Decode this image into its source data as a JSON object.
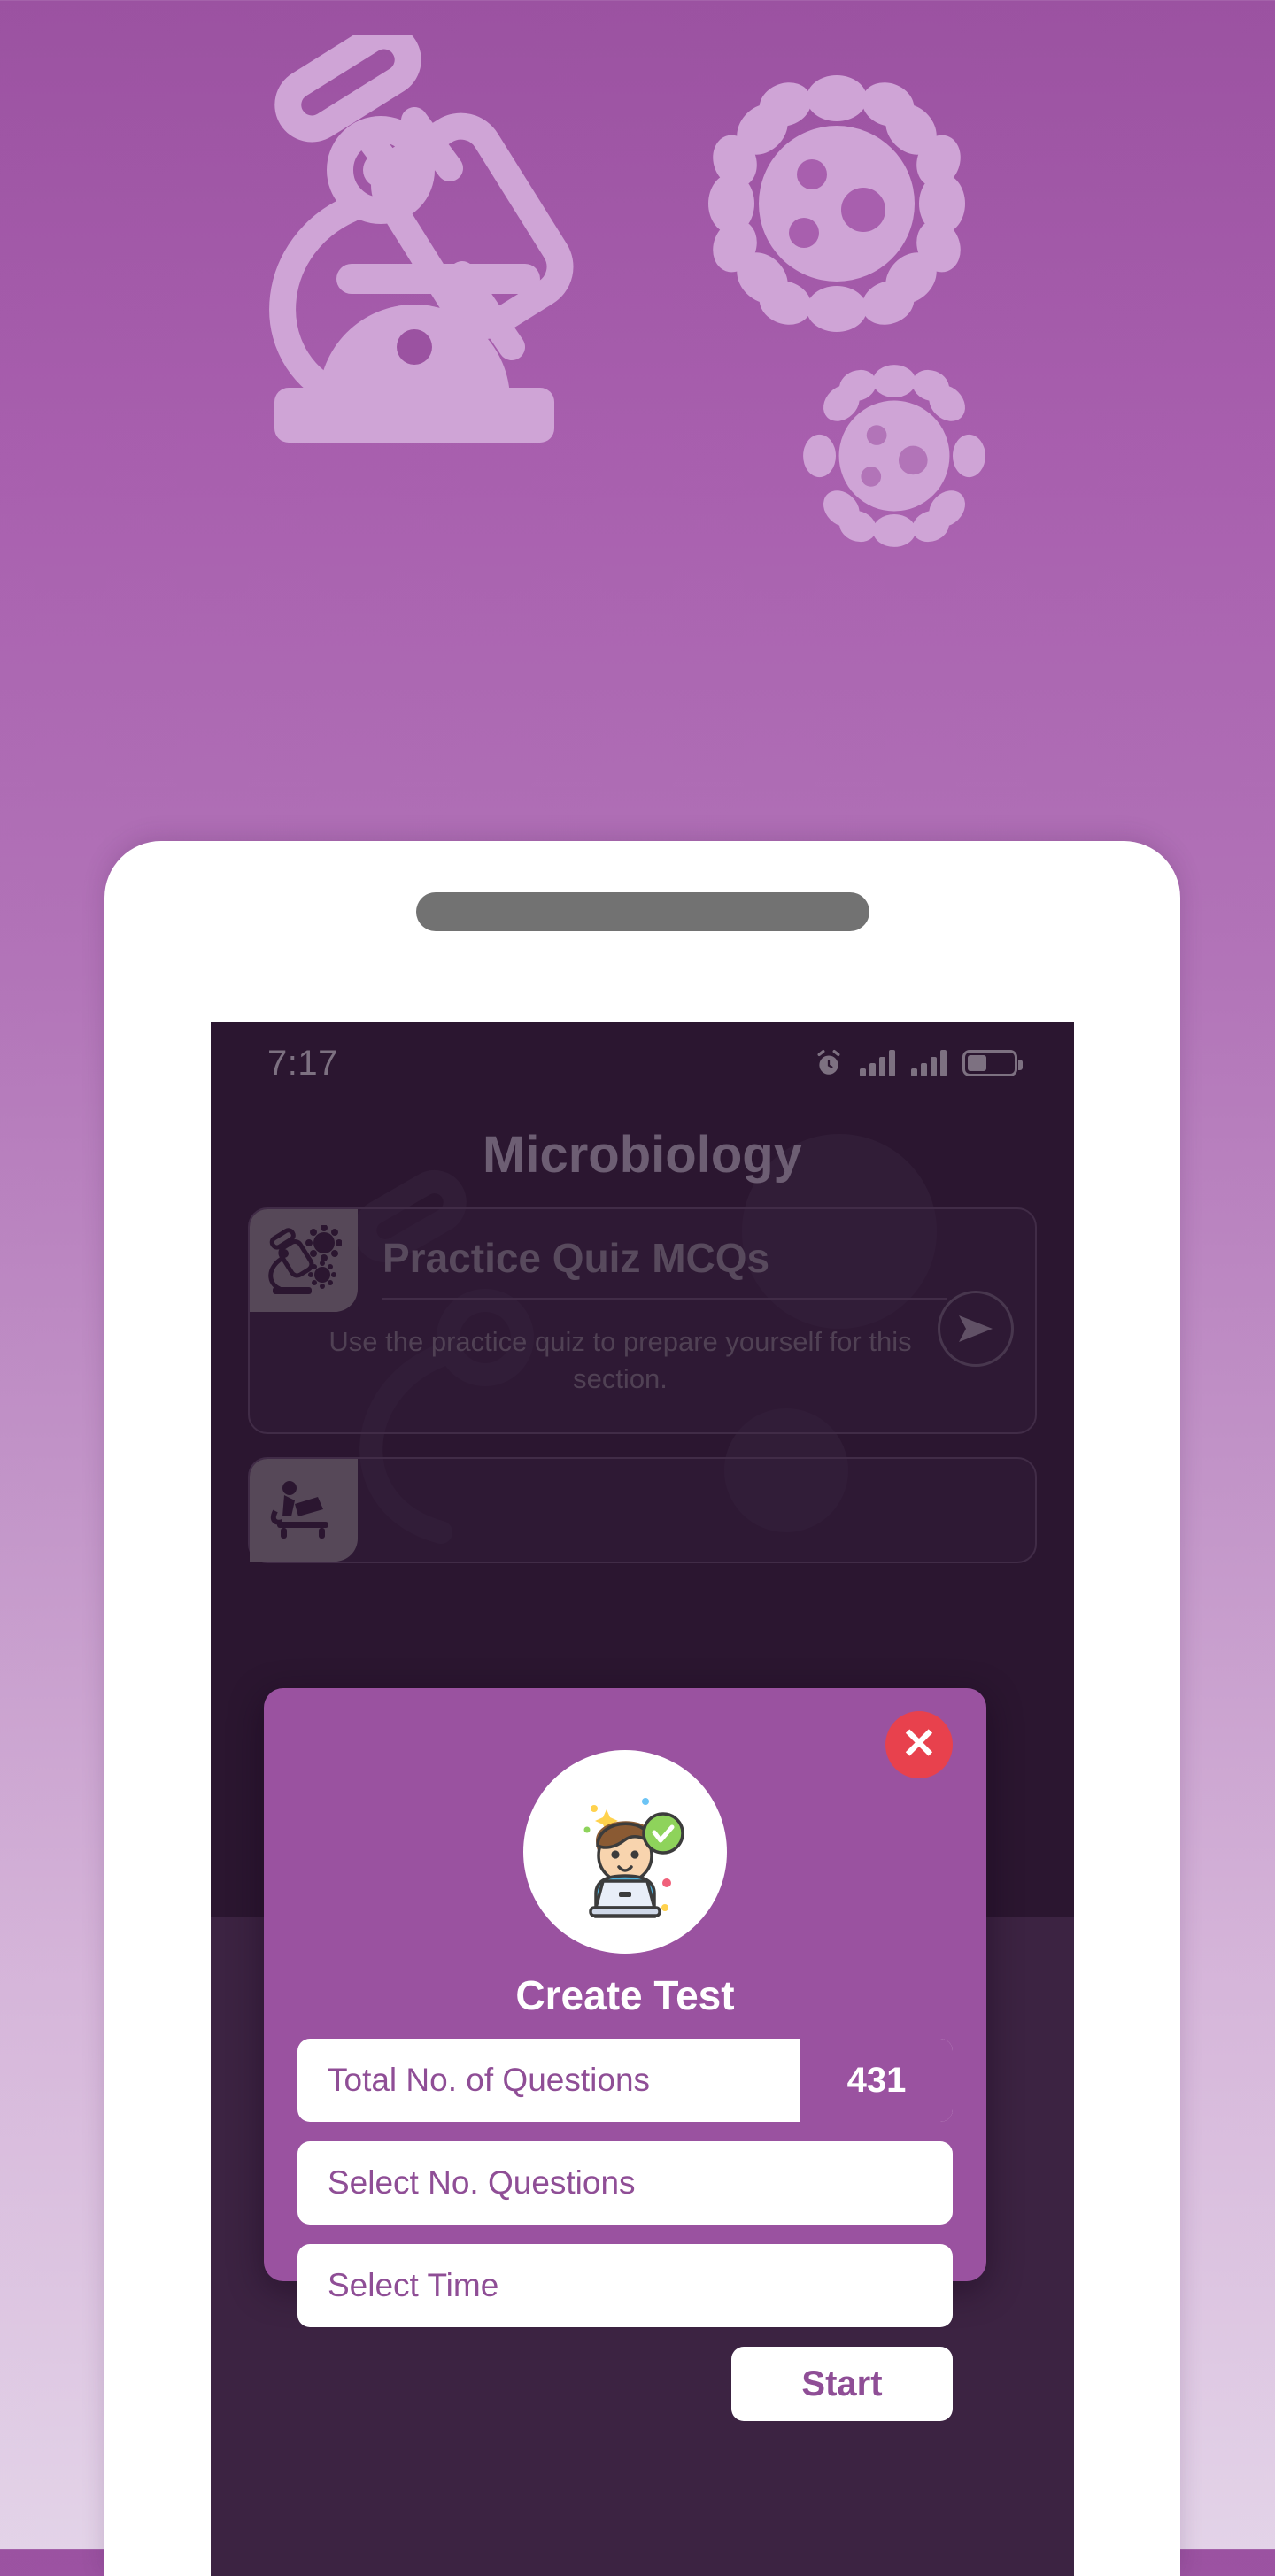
{
  "hero": {
    "icons": [
      "microscope-illustration",
      "virus-large-illustration",
      "virus-small-illustration"
    ]
  },
  "phone": {
    "speaker_name": "phone-speaker-grille"
  },
  "statusbar": {
    "time": "7:17",
    "alarm_icon": "alarm-clock-icon",
    "signal_1_icon": "signal-bars-icon",
    "signal_2_icon": "signal-bars-icon",
    "battery_icon": "battery-icon",
    "battery_level_pct": 42
  },
  "app": {
    "title": "Microbiology",
    "cards": [
      {
        "title": "Practice Quiz MCQs",
        "description": "Use the practice quiz to prepare yourself for this section.",
        "icon": "microscope-virus-icon",
        "arrow": "send-arrow-icon"
      },
      {
        "title": "",
        "description": "",
        "icon": "person-studying-icon",
        "arrow": "send-arrow-icon"
      }
    ]
  },
  "modal": {
    "close_label": "✕",
    "close_icon": "close-x-icon",
    "avatar_icon": "student-laptop-avatar-icon",
    "title": "Create Test",
    "fields": [
      {
        "label": "Total No. of Questions",
        "value": "431"
      },
      {
        "label": "Select No. Questions",
        "value": ""
      },
      {
        "label": "Select Time",
        "value": ""
      }
    ],
    "start_label": "Start"
  },
  "colors": {
    "brand_purple": "#9a52a0",
    "screen_bg": "#3c2342",
    "close_red": "#e8414d",
    "field_white": "#ffffff",
    "page_bg_top": "#9b52a1",
    "page_bg_bottom": "#e3d3e8"
  }
}
